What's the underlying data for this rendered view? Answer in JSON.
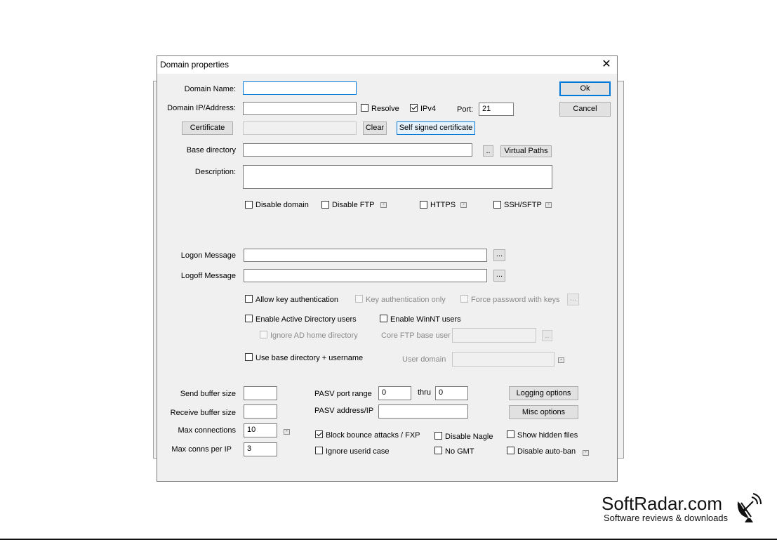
{
  "dialog": {
    "title": "Domain properties",
    "close_glyph": "✕",
    "ok_label": "Ok",
    "cancel_label": "Cancel"
  },
  "domain": {
    "name_label": "Domain Name:",
    "name_value": "",
    "ip_label": "Domain IP/Address:",
    "ip_value": "",
    "resolve_label": "Resolve",
    "ipv4_label": "IPv4",
    "port_label": "Port:",
    "port_value": "21",
    "certificate_button": "Certificate",
    "certificate_value": "",
    "clear_button": "Clear",
    "self_signed_button": "Self signed certificate",
    "basedir_label": "Base directory",
    "basedir_value": "",
    "browse_small": "..",
    "virtual_paths_button": "Virtual Paths",
    "description_label": "Description:",
    "description_value": ""
  },
  "flags": {
    "disable_domain": "Disable domain",
    "disable_ftp": "Disable FTP",
    "https": "HTTPS",
    "ssh_sftp": "SSH/SFTP",
    "mini_glyph": "-"
  },
  "messages": {
    "logon_label": "Logon Message",
    "logon_value": "",
    "logoff_label": "Logoff Message",
    "logoff_value": "",
    "ellipsis": "..."
  },
  "auth": {
    "allow_key": "Allow key authentication",
    "key_only": "Key authentication only",
    "force_pw": "Force password with keys",
    "ellipsis": "...",
    "enable_ad": "Enable Active Directory users",
    "enable_winnt": "Enable WinNT users",
    "ignore_ad_home": "Ignore AD home directory",
    "core_ftp_base_user": "Core FTP base user",
    "core_ftp_base_user_value": "",
    "browse_small": "..",
    "use_base_dir": "Use base directory + username",
    "user_domain": "User domain",
    "user_domain_value": ""
  },
  "buffers": {
    "send_label": "Send buffer size",
    "send_value": "",
    "receive_label": "Receive buffer size",
    "receive_value": "",
    "max_conn_label": "Max connections",
    "max_conn_value": "10",
    "max_per_ip_label": "Max conns per IP",
    "max_per_ip_value": "3"
  },
  "pasv": {
    "range_label": "PASV port range",
    "from_value": "0",
    "thru_label": "thru",
    "to_value": "0",
    "address_label": "PASV address/IP",
    "address_value": ""
  },
  "options": {
    "logging_button": "Logging options",
    "misc_button": "Misc options",
    "block_bounce": "Block bounce attacks / FXP",
    "disable_nagle": "Disable Nagle",
    "show_hidden": "Show hidden files",
    "ignore_userid_case": "Ignore userid case",
    "no_gmt": "No GMT",
    "disable_autoban": "Disable auto-ban"
  },
  "watermark": {
    "brand": "SoftRadar.com",
    "tagline": "Software reviews & downloads"
  }
}
